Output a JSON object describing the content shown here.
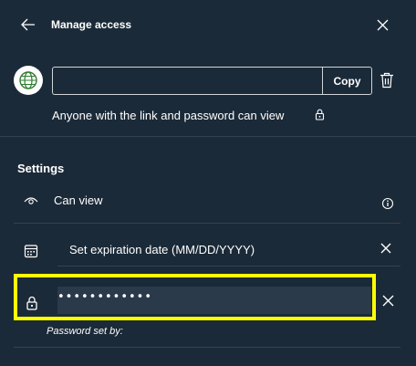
{
  "header": {
    "title": "Manage access"
  },
  "link": {
    "value": "",
    "copy_label": "Copy",
    "description": "Anyone with the link and password can view"
  },
  "settings": {
    "title": "Settings",
    "permission_label": "Can view",
    "expiration_label": "Set expiration date (MM/DD/YYYY)",
    "password_value": "••••••••••••",
    "password_caption": "Password set by:"
  },
  "colors": {
    "background": "#1b2a38",
    "highlight": "#ffff00",
    "globe_accent": "#2e7d32",
    "field": "#2b3a4a"
  },
  "icons": [
    "back-arrow-icon",
    "close-icon",
    "globe-icon",
    "trash-icon",
    "lock-icon",
    "eye-icon",
    "info-icon",
    "calendar-icon",
    "clear-icon"
  ]
}
